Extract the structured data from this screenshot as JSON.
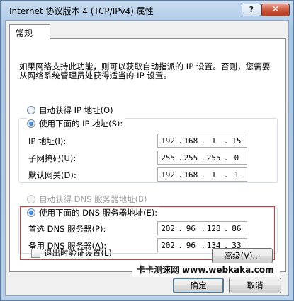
{
  "window": {
    "title": "Internet 协议版本 4 (TCP/IPv4) 属性",
    "help_label": "?",
    "close_label": "✕"
  },
  "tab": {
    "label": "常规"
  },
  "description": "如果网络支持此功能，则可以获取自动指派的 IP 设置。否则，您需要从网络系统管理员处获得适当的 IP 设置。",
  "ip_section": {
    "auto_label": "自动获得 IP 地址(O)",
    "manual_label": "使用下面的 IP 地址(S):",
    "selected": "manual",
    "fields": [
      {
        "label": "IP 地址(I):",
        "value": [
          "192",
          "168",
          "1",
          "15"
        ]
      },
      {
        "label": "子网掩码(U):",
        "value": [
          "255",
          "255",
          "255",
          "0"
        ]
      },
      {
        "label": "默认网关(D):",
        "value": [
          "192",
          "168",
          "1",
          "1"
        ]
      }
    ]
  },
  "dns_section": {
    "auto_label": "自动获得 DNS 服务器地址(B)",
    "manual_label": "使用下面的 DNS 服务器地址(E):",
    "selected": "manual",
    "fields": [
      {
        "label": "首选 DNS 服务器(P):",
        "value": [
          "202",
          "96",
          "128",
          "86"
        ]
      },
      {
        "label": "备用 DNS 服务器(A):",
        "value": [
          "202",
          "96",
          "134",
          "33"
        ]
      }
    ]
  },
  "validate_on_exit": {
    "label": "退出时验证设置(L)",
    "checked": false
  },
  "buttons": {
    "advanced": "高级(V)...",
    "ok": "确定",
    "cancel": "取消"
  },
  "watermark": "卡卡测速网 www.webkaka.com",
  "colors": {
    "highlight_frame": "#d63a3a",
    "titlebar": "#b9d1ea"
  }
}
